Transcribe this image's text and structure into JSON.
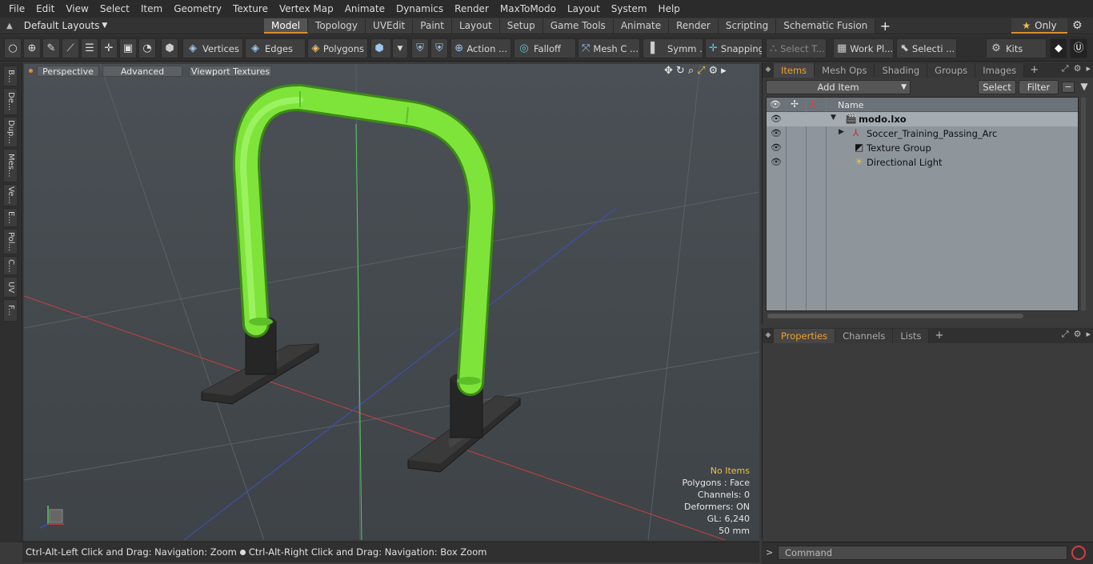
{
  "menu": [
    "File",
    "Edit",
    "View",
    "Select",
    "Item",
    "Geometry",
    "Texture",
    "Vertex Map",
    "Animate",
    "Dynamics",
    "Render",
    "MaxToModo",
    "Layout",
    "System",
    "Help"
  ],
  "layouts_label": "Default Layouts",
  "tabs": [
    "Model",
    "Topology",
    "UVEdit",
    "Paint",
    "Layout",
    "Setup",
    "Game Tools",
    "Animate",
    "Render",
    "Scripting",
    "Schematic Fusion"
  ],
  "active_tab": "Model",
  "only_label": "Only",
  "toolbar": {
    "vertices": "Vertices",
    "edges": "Edges",
    "polygons": "Polygons",
    "action": "Action ...",
    "falloff": "Falloff",
    "mesh": "Mesh C ...",
    "symm": "Symm ...",
    "snapping": "Snapping",
    "select_t": "Select T...",
    "workplane": "Work Pl...",
    "selecti": "Selecti ...",
    "kits": "Kits"
  },
  "left_tabs": [
    "B...",
    "De...",
    "Dup...",
    "Mes...",
    "Ve...",
    "E...",
    "Pol...",
    "C...",
    "UV",
    "F..."
  ],
  "viewport": {
    "perspective": "Perspective",
    "advanced": "Advanced",
    "textures": "Viewport Textures",
    "info": {
      "no_items": "No Items",
      "polygons": "Polygons : Face",
      "channels": "Channels: 0",
      "deformers": "Deformers: ON",
      "gl": "GL: 6,240",
      "scale": "50 mm"
    }
  },
  "status_left": "Ctrl-Alt-Left Click and Drag: Navigation: Zoom",
  "status_right": "Ctrl-Alt-Right Click and Drag: Navigation: Box Zoom",
  "items_panel": {
    "tabs": [
      "Items",
      "Mesh Ops",
      "Shading",
      "Groups",
      "Images"
    ],
    "active": "Items",
    "add_item": "Add Item",
    "select": "Select",
    "filter": "Filter",
    "column_name": "Name",
    "rows": [
      {
        "label": "modo.lxo",
        "bold": true
      },
      {
        "label": "Soccer_Training_Passing_Arc"
      },
      {
        "label": "Texture Group"
      },
      {
        "label": "Directional Light"
      }
    ]
  },
  "props_panel": {
    "tabs": [
      "Properties",
      "Channels",
      "Lists"
    ],
    "active": "Properties"
  },
  "command_placeholder": "Command",
  "colors": {
    "accent": "#e0902a",
    "arc_green": "#7ee43a",
    "base_dark": "#2e2e2e"
  }
}
